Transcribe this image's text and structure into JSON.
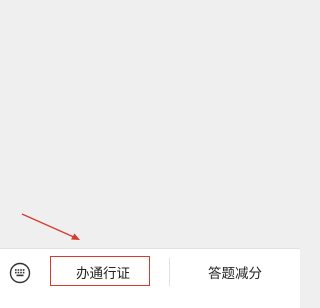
{
  "menu": {
    "items": [
      {
        "label": "办通行证"
      },
      {
        "label": "答题减分"
      }
    ]
  },
  "keyboard_toggle": {
    "icon": "keyboard-icon"
  },
  "annotation": {
    "color": "#d63b2f",
    "arrow_target": "menu-item-pass"
  }
}
